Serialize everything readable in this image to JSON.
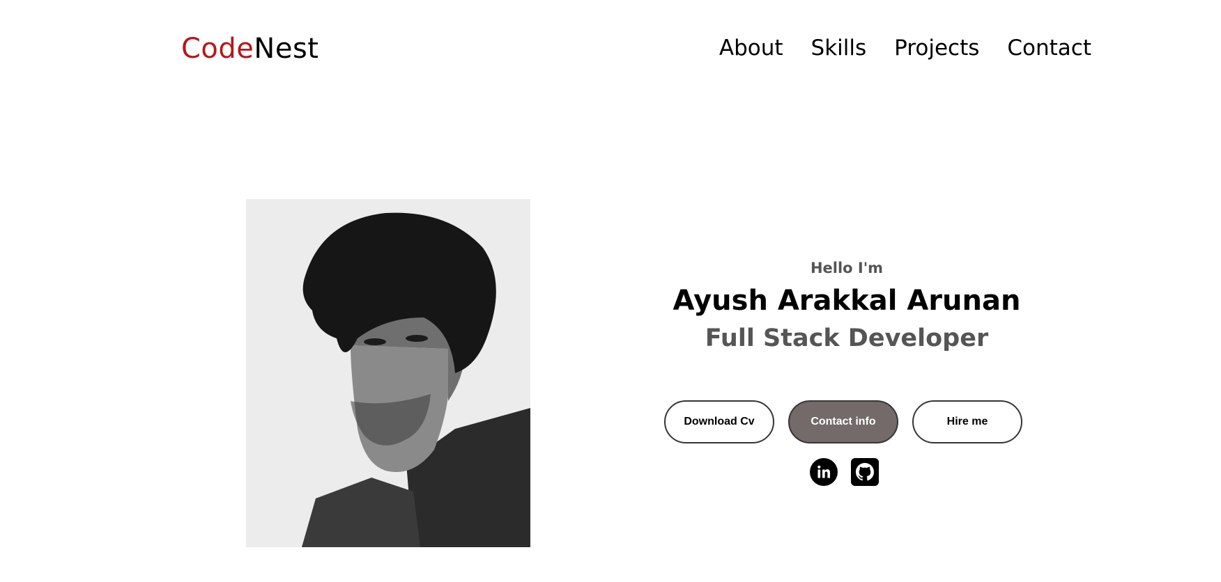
{
  "header": {
    "logo_accent": "Code",
    "logo_rest": "Nest",
    "nav": [
      "About",
      "Skills",
      "Projects",
      "Contact"
    ]
  },
  "hero": {
    "greeting": "Hello I'm",
    "name": "Ayush Arakkal Arunan",
    "role": "Full Stack Developer",
    "buttons": {
      "download": "Download Cv",
      "contact": "Contact info",
      "hire": "Hire me"
    },
    "socials": [
      {
        "icon": "linkedin-icon"
      },
      {
        "icon": "github-icon"
      }
    ]
  },
  "colors": {
    "accent": "#b5161a",
    "button_filled": "#736a69",
    "text_muted": "#555555"
  }
}
